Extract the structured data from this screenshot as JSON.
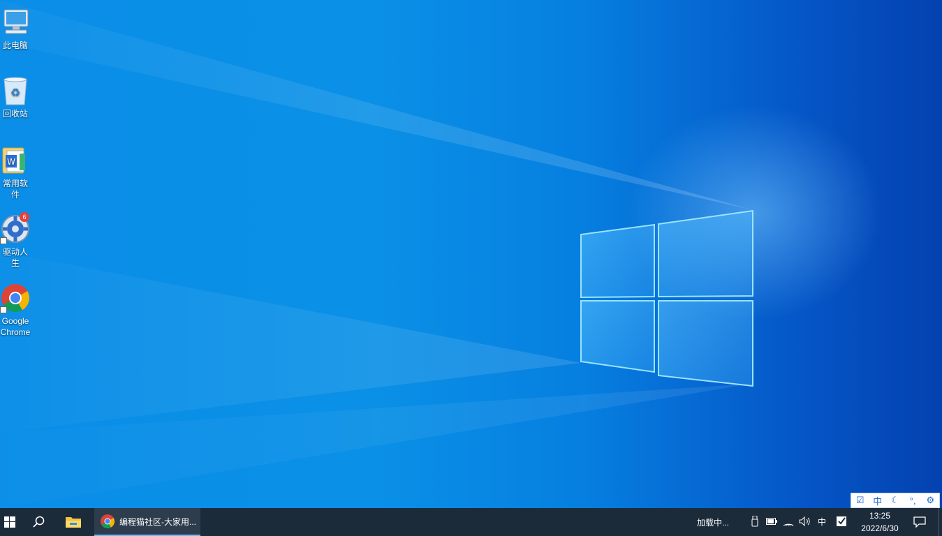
{
  "desktop": {
    "icons": [
      {
        "label": "此电脑",
        "icon": "computer-icon"
      },
      {
        "label": "回收站",
        "icon": "recycle-bin-icon"
      },
      {
        "label": "常用软件",
        "icon": "folder-icon"
      },
      {
        "label": "驱动人生",
        "icon": "driver-gear-icon",
        "badge": "6"
      },
      {
        "label": "Google\nChrome",
        "icon": "chrome-icon"
      }
    ]
  },
  "ime_toolbar": {
    "items": [
      "checkbox-icon",
      "中",
      "moon-icon",
      "punctuation-icon",
      "gear-icon"
    ],
    "mode_label": "中"
  },
  "taskbar": {
    "start": "windows-logo-icon",
    "search": "search-icon",
    "pinned": [
      {
        "name": "file-explorer",
        "icon": "folder-icon"
      }
    ],
    "running": [
      {
        "title": "编程猫社区-大家用...",
        "icon": "chrome-icon"
      }
    ],
    "tray": {
      "loading_text": "加载中...",
      "icons": [
        "usb-icon",
        "battery-icon",
        "wifi-icon",
        "volume-icon",
        "ime-icon",
        "security-check-icon"
      ],
      "ime_label": "中",
      "time": "13:25",
      "date": "2022/6/30"
    },
    "notification": "action-center-icon"
  },
  "colors": {
    "taskbar_bg": "#1c2b3a",
    "wallpaper_blue": "#0a8ee8",
    "accent": "#76b9ed",
    "ime_blue": "#1a66d1"
  }
}
